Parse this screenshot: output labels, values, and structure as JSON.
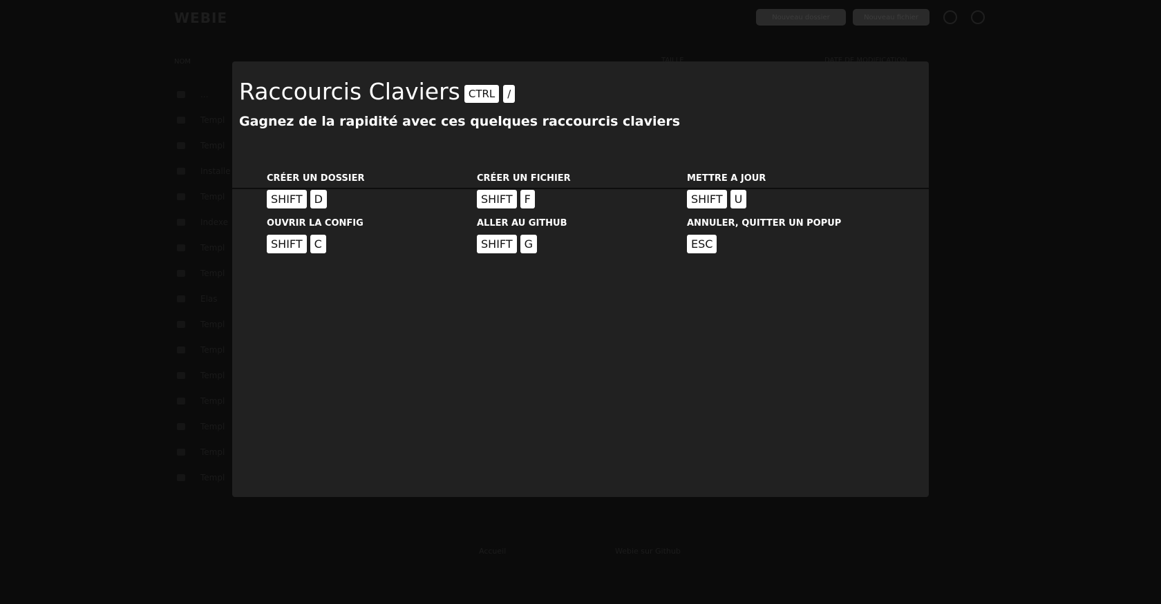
{
  "background": {
    "logo": "WEBIE",
    "top_buttons": [
      "Nouveau dossier",
      "Nouveau fichier"
    ],
    "sidebar_heading": "NOM",
    "sidebar_items": [
      "...",
      "Templ",
      "Templ",
      "Installe",
      "Templ",
      "Indexe",
      "Templ",
      "Templ",
      "Elas",
      "Templ",
      "Templ",
      "Templ",
      "Templ",
      "Templ",
      "Templ",
      "Templ"
    ],
    "column_heads": [
      "TAILLE",
      "DATE DE MODIFICATION"
    ],
    "footer": [
      "Accueil",
      "Webie sur Github"
    ]
  },
  "modal": {
    "title": "Raccourcis Claviers",
    "title_keys": [
      "CTRL",
      "/"
    ],
    "subtitle": "Gagnez de la rapidité avec ces quelques raccourcis claviers",
    "shortcuts": [
      {
        "label": "CRÉER UN DOSSIER",
        "keys": [
          "SHIFT",
          "D"
        ]
      },
      {
        "label": "CRÉER UN FICHIER",
        "keys": [
          "SHIFT",
          "F"
        ]
      },
      {
        "label": "METTRE A JOUR",
        "keys": [
          "SHIFT",
          "U"
        ]
      },
      {
        "label": "OUVRIR LA CONFIG",
        "keys": [
          "SHIFT",
          "C"
        ]
      },
      {
        "label": "ALLER AU GITHUB",
        "keys": [
          "SHIFT",
          "G"
        ]
      },
      {
        "label": "ANNULER, QUITTER UN POPUP",
        "keys": [
          "ESC"
        ]
      }
    ]
  }
}
